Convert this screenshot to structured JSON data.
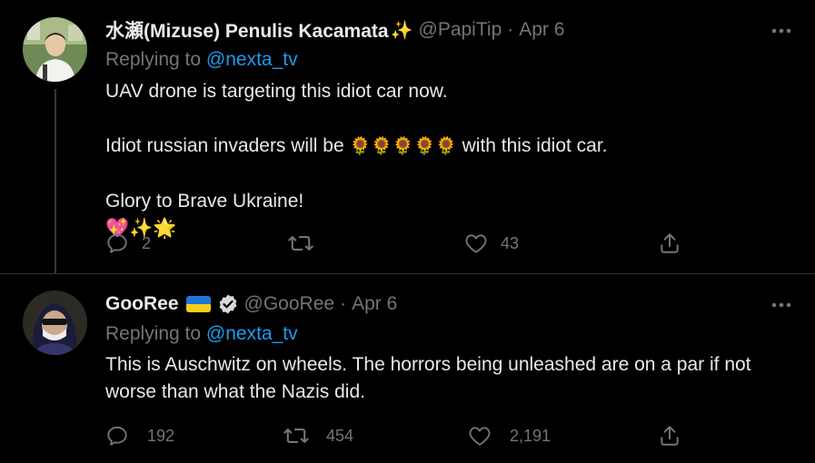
{
  "tweets": [
    {
      "display_name": "水瀬(Mizuse) Penulis Kacamata",
      "name_emoji": "✨",
      "handle": "@PapiTip",
      "separator": "·",
      "date": "Apr 6",
      "replying_prefix": "Replying to",
      "replying_mention": "@nexta_tv",
      "line1": "UAV drone is targeting this idiot car now.",
      "line2_before": "Idiot russian invaders will be",
      "line2_emojis": "🌻🌻🌻🌻🌻",
      "line2_after": "with this idiot car.",
      "line3": "Glory to Brave Ukraine!",
      "line3_emojis": "💖✨🌟",
      "replies": "2",
      "retweets": "",
      "likes": "43"
    },
    {
      "display_name": "GooRee",
      "handle": "@GooRee",
      "separator": "·",
      "date": "Apr 6",
      "replying_prefix": "Replying to",
      "replying_mention": "@nexta_tv",
      "line1": "This is Auschwitz on wheels. The horrors being unleashed are on a par if not",
      "line2": "worse than what the Nazis did.",
      "replies": "192",
      "retweets": "454",
      "likes": "2,191"
    }
  ],
  "icons": {
    "more": "more-horizontal-icon",
    "reply": "reply-icon",
    "retweet": "retweet-icon",
    "like": "like-icon",
    "share": "share-icon",
    "verified": "verified-badge-icon",
    "flag": "ukraine-flag-icon"
  },
  "colors": {
    "background": "#000000",
    "text": "#e7e9ea",
    "secondary": "#71767b",
    "link": "#1d9bf0",
    "divider": "#2f3336"
  }
}
